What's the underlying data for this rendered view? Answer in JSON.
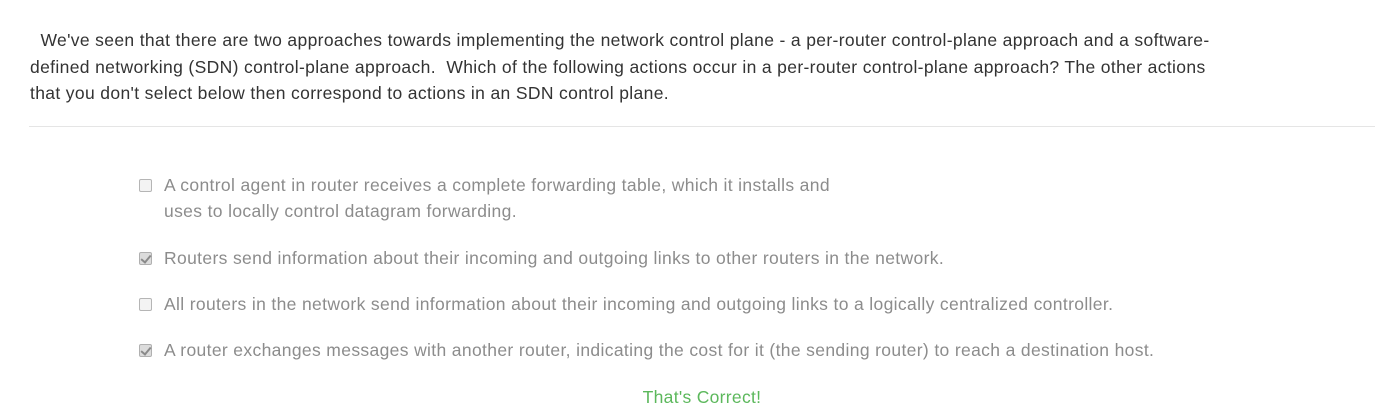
{
  "question": {
    "text": "  We've seen that there are two approaches towards implementing the network control plane - a per-router control-plane approach and a software-\ndefined networking (SDN) control-plane approach.  Which of the following actions occur in a per-router control-plane approach? The other actions\nthat you don't select below then correspond to actions in an SDN control plane."
  },
  "options": [
    {
      "label": "A control agent in router receives a complete forwarding table, which it installs and\nuses to locally control datagram forwarding.",
      "checked": false
    },
    {
      "label": "Routers send information about their incoming and outgoing links to other routers in the network.",
      "checked": true
    },
    {
      "label": "All routers in the network send information about their incoming and outgoing links to a logically centralized controller.",
      "checked": false
    },
    {
      "label": "A router exchanges messages with another router, indicating the cost for it (the sending router) to reach a destination host.",
      "checked": true
    }
  ],
  "feedback": {
    "text": "That's Correct!",
    "color": "#5cb85c"
  }
}
